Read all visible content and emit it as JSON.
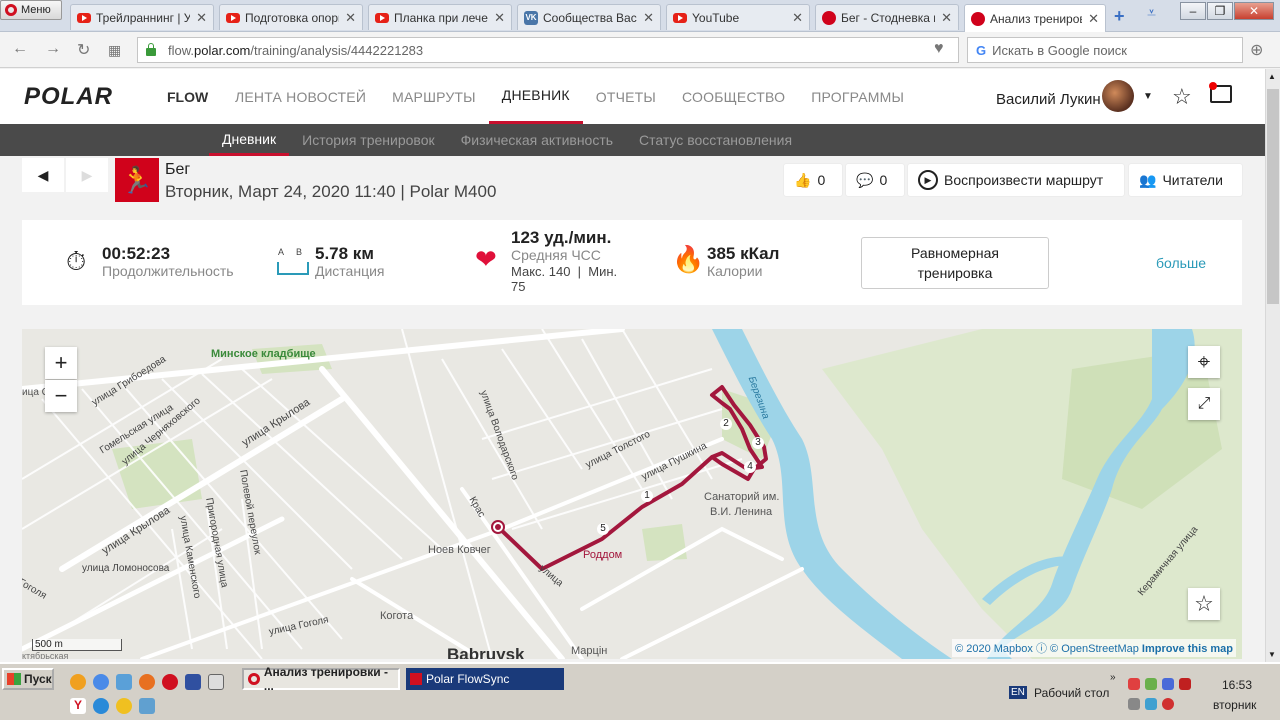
{
  "browser": {
    "menu_label": "Меню",
    "tabs": [
      {
        "title": "Трейлраннинг | Упр",
        "icon": "youtube-icon"
      },
      {
        "title": "Подготовка опорн",
        "icon": "youtube-icon"
      },
      {
        "title": "Планка при лечени",
        "icon": "youtube-icon"
      },
      {
        "title": "Сообщества Васил",
        "icon": "vk-icon"
      },
      {
        "title": "YouTube",
        "icon": "youtube-icon"
      },
      {
        "title": "Бег - Стодневка п",
        "icon": "polar-icon"
      },
      {
        "title": "Анализ тренирово",
        "icon": "polar-icon"
      }
    ],
    "url_prefix": "flow.",
    "url_domain": "polar.com",
    "url_path": "/training/analysis/4442221283",
    "search_placeholder": "Искать в Google поиск"
  },
  "header": {
    "logo": "POLAR",
    "logo_sub": "FLOW",
    "nav": [
      "ЛЕНТА НОВОСТЕЙ",
      "МАРШРУТЫ",
      "ДНЕВНИК",
      "ОТЧЕТЫ",
      "СООБЩЕСТВО",
      "ПРОГРАММЫ"
    ],
    "user_name": "Василий Лукин"
  },
  "subnav": [
    "Дневник",
    "История тренировок",
    "Физическая активность",
    "Статус восстановления"
  ],
  "activity": {
    "sport": "Бег",
    "date_device": "Вторник, Март 24, 2020 11:40 | Polar M400",
    "likes": "0",
    "comments": "0",
    "replay_label": "Воспроизвести маршрут",
    "readers_label": "Читатели"
  },
  "summary": {
    "duration": "00:52:23",
    "duration_label": "Продолжительность",
    "distance_ab": "A     B",
    "distance": "5.78 км",
    "distance_label": "Дистанция",
    "hr": "123 уд./мин.",
    "hr_label": "Средняя ЧСС",
    "hr_minmax_1": "Макс. 140  |  Мин.",
    "hr_minmax_2": "75",
    "calories": "385 кКал",
    "calories_label": "Калории",
    "type_line1": "Равномерная",
    "type_line2": "тренировка",
    "more": "больше"
  },
  "map": {
    "labels": {
      "cemetery": "Минское кладбище",
      "gribo": "улица Грибоедова",
      "gomel": "Гомельская улица",
      "cherny": "улица Черняховского",
      "krylova1": "улица Крылова",
      "krylova2": "улица Крылова",
      "volod": "улица Володарского",
      "tolstogo": "улица Толстого",
      "pushkina": "улица Пушкина",
      "sanat1": "Санаторий им.",
      "sanat2": "В.И. Ленина",
      "roddom": "Роддом",
      "kovcheg": "Ноев Ковчег",
      "kogota": "Когота",
      "babruysk": "Babruysk",
      "martsin": "Марцін",
      "lomonosov": "улица Ломоносова",
      "gogolya": "улица Гоголя",
      "gogolya2": "Гоголя",
      "polevoy": "Полевой переулок",
      "prigorod": "Пригородная улица",
      "kamen": "улица Каменского",
      "keramich": "Керамичная улица",
      "berezina": "Березина",
      "krasn": "Крас",
      "ulitsa": "улица",
      "scale": "500 m",
      "left1": "ица С",
      "bottom_left": "ктябрьская"
    },
    "markers": [
      "1",
      "2",
      "3",
      "4",
      "5"
    ],
    "attrib_1": "© 2020 Mapbox",
    "attrib_2": "© OpenStreetMap",
    "attrib_3": "Improve this map"
  },
  "taskbar": {
    "start": "Пуск",
    "tasks": [
      "Анализ тренировки - ...",
      "Polar FlowSync"
    ],
    "lang": "EN",
    "desktop": "Рабочий стол",
    "time": "16:53",
    "day": "вторник"
  },
  "colors": {
    "accent": "#c8102e",
    "route": "#a3173d"
  }
}
